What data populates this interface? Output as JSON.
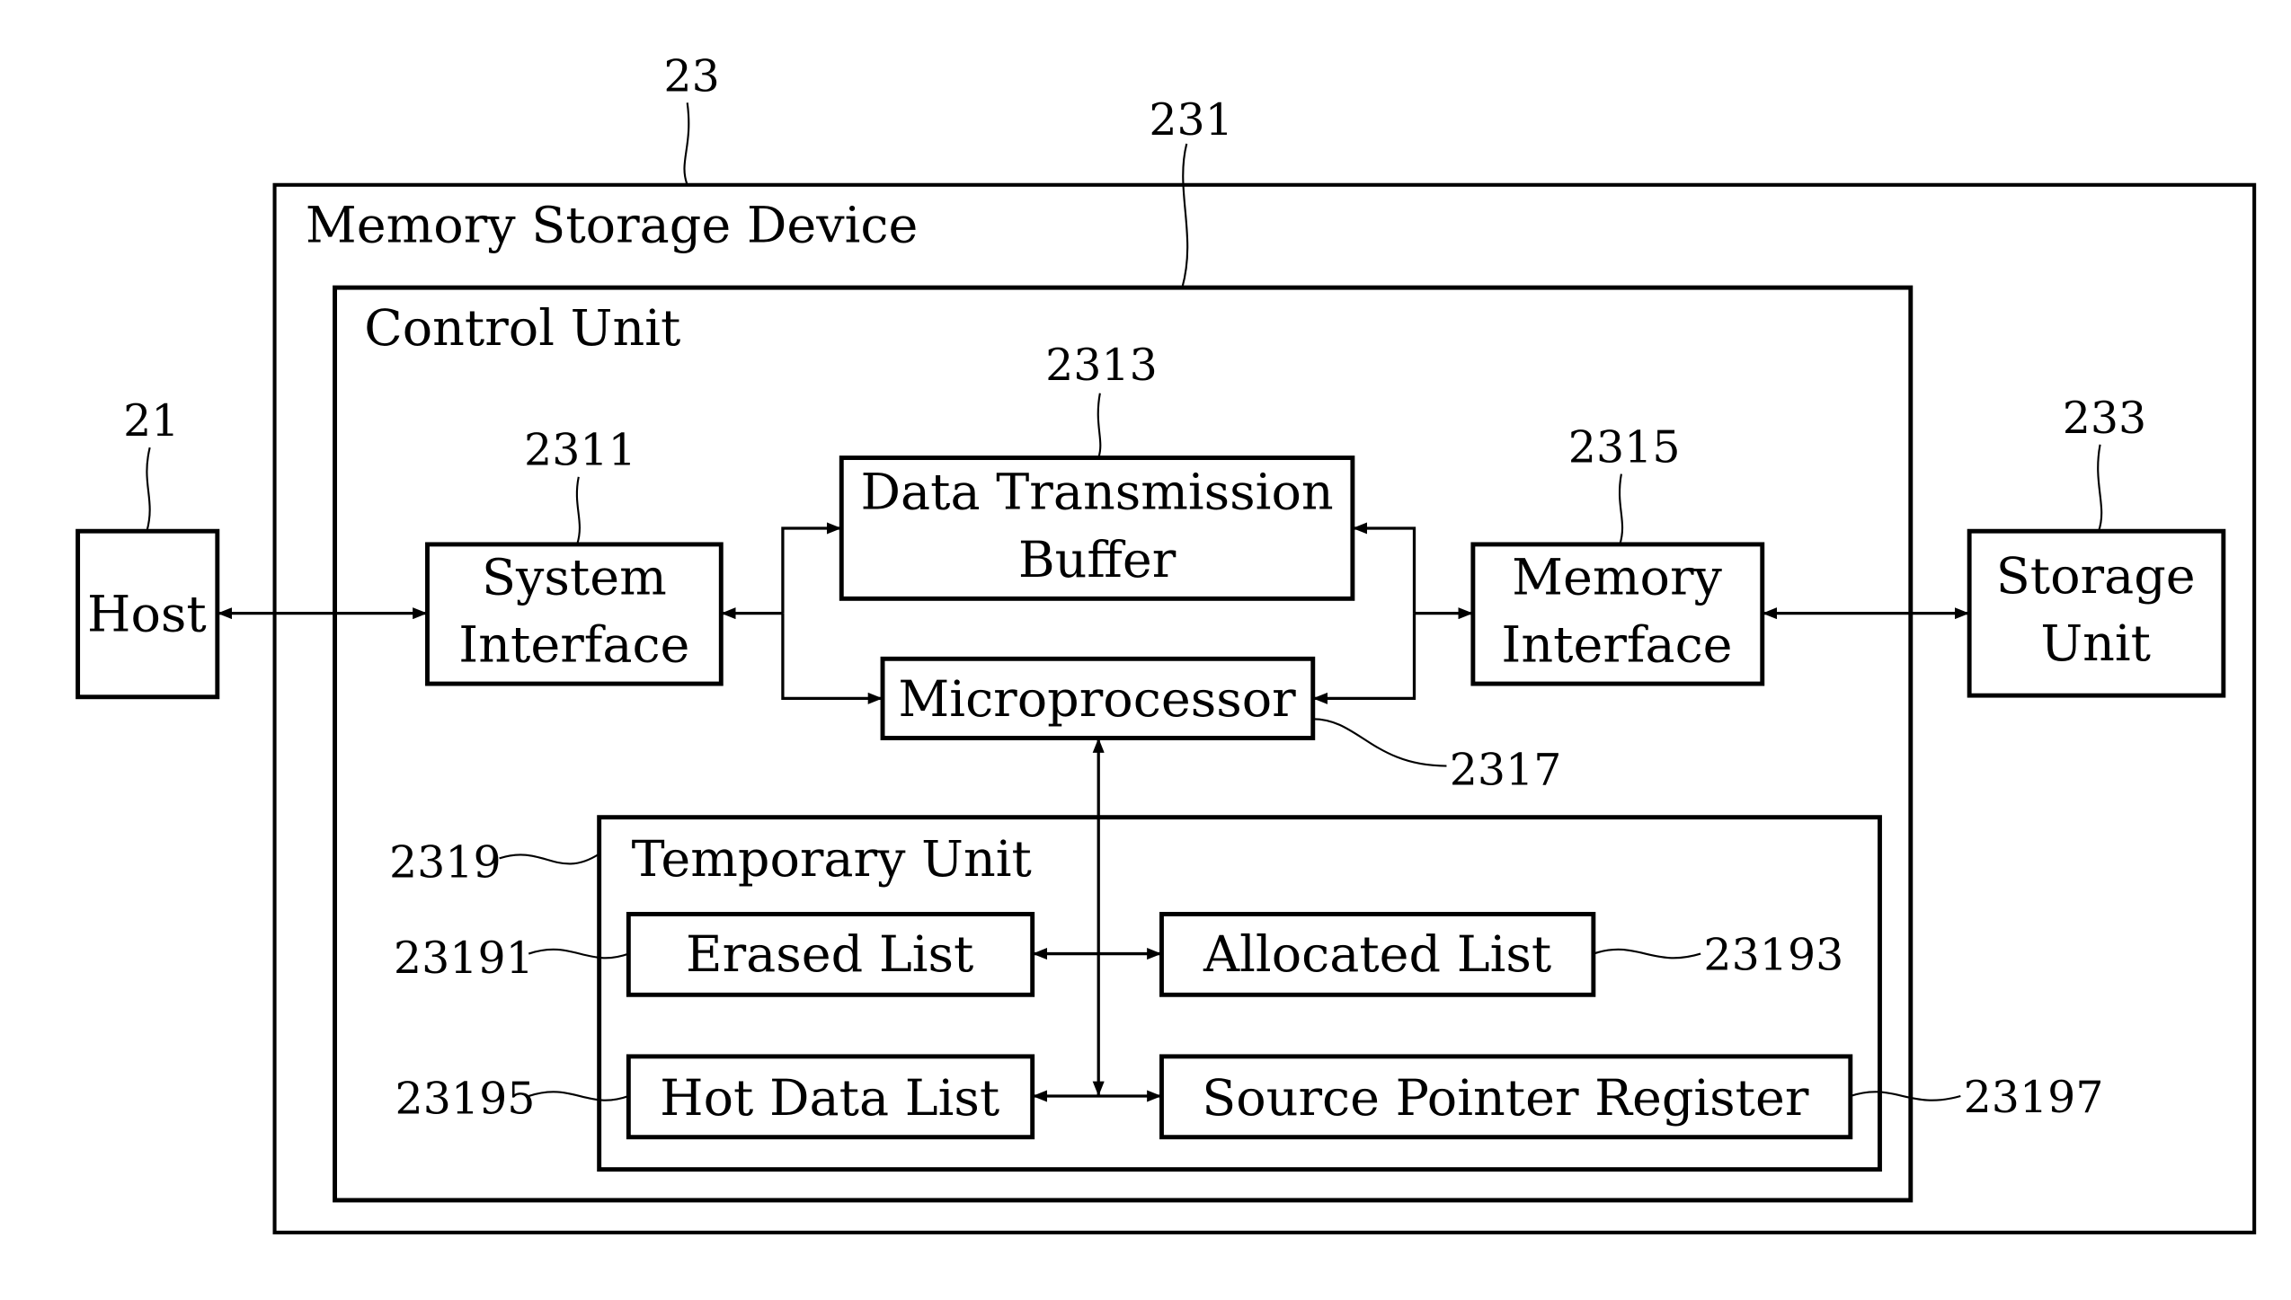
{
  "refs": {
    "host": "21",
    "device": "23",
    "control_unit": "231",
    "storage_unit": "233",
    "system_interface": "2311",
    "buffer": "2313",
    "memory_interface": "2315",
    "microprocessor": "2317",
    "temporary_unit": "2319",
    "erased_list": "23191",
    "allocated_list": "23193",
    "hot_data_list": "23195",
    "source_pointer_register": "23197"
  },
  "labels": {
    "device": "Memory Storage Device",
    "control_unit": "Control Unit",
    "host": "Host",
    "system_interface": [
      "System",
      "Interface"
    ],
    "buffer": [
      "Data Transmission",
      "Buffer"
    ],
    "memory_interface": [
      "Memory",
      "Interface"
    ],
    "storage_unit": [
      "Storage",
      "Unit"
    ],
    "microprocessor": "Microprocessor",
    "temporary_unit": "Temporary Unit",
    "erased_list": "Erased List",
    "allocated_list": "Allocated List",
    "hot_data_list": "Hot Data List",
    "source_pointer_register": "Source Pointer Register"
  }
}
